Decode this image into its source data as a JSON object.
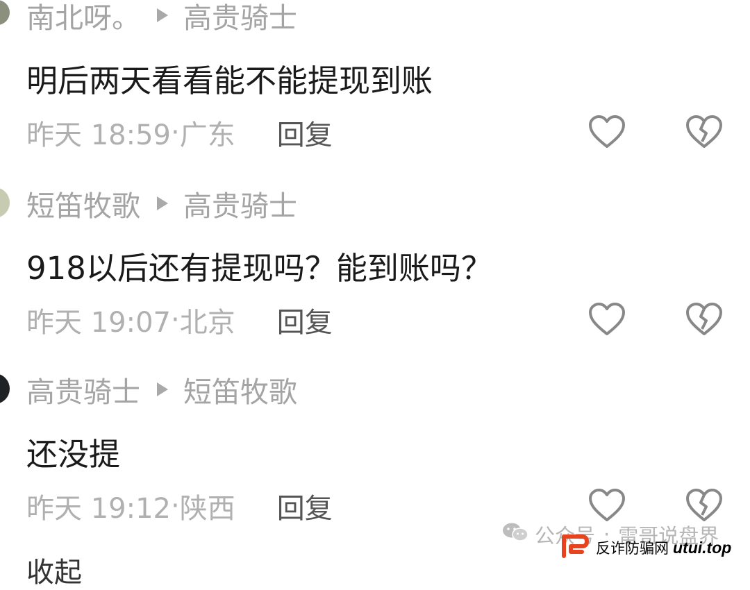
{
  "comments": [
    {
      "author": "南北呀。",
      "reply_to": "高贵骑士",
      "text": "明后两天看看能不能提现到账",
      "time": "昨天 18:59",
      "location": "广东",
      "reply_label": "回复"
    },
    {
      "author": "短笛牧歌",
      "reply_to": "高贵骑士",
      "text": "918以后还有提现吗？能到账吗？",
      "time": "昨天 19:07",
      "location": "北京",
      "reply_label": "回复"
    },
    {
      "author": "高贵骑士",
      "reply_to": "短笛牧歌",
      "text": "还没提",
      "time": "昨天 19:12",
      "location": "陕西",
      "reply_label": "回复"
    }
  ],
  "fold_label": "收起",
  "watermark": {
    "prefix": "公众号",
    "separator": "·",
    "name": "雷哥说盘界",
    "icon": "wechat-icon"
  },
  "badge": {
    "text": "反诈防骗网",
    "site": "utui.top",
    "icon": "fanzha-logo-icon",
    "accent": "#e8431f"
  },
  "colors": {
    "meta": "#a4a4a4",
    "content": "#1a1a1a",
    "reply": "#555555",
    "icon": "#888888"
  }
}
